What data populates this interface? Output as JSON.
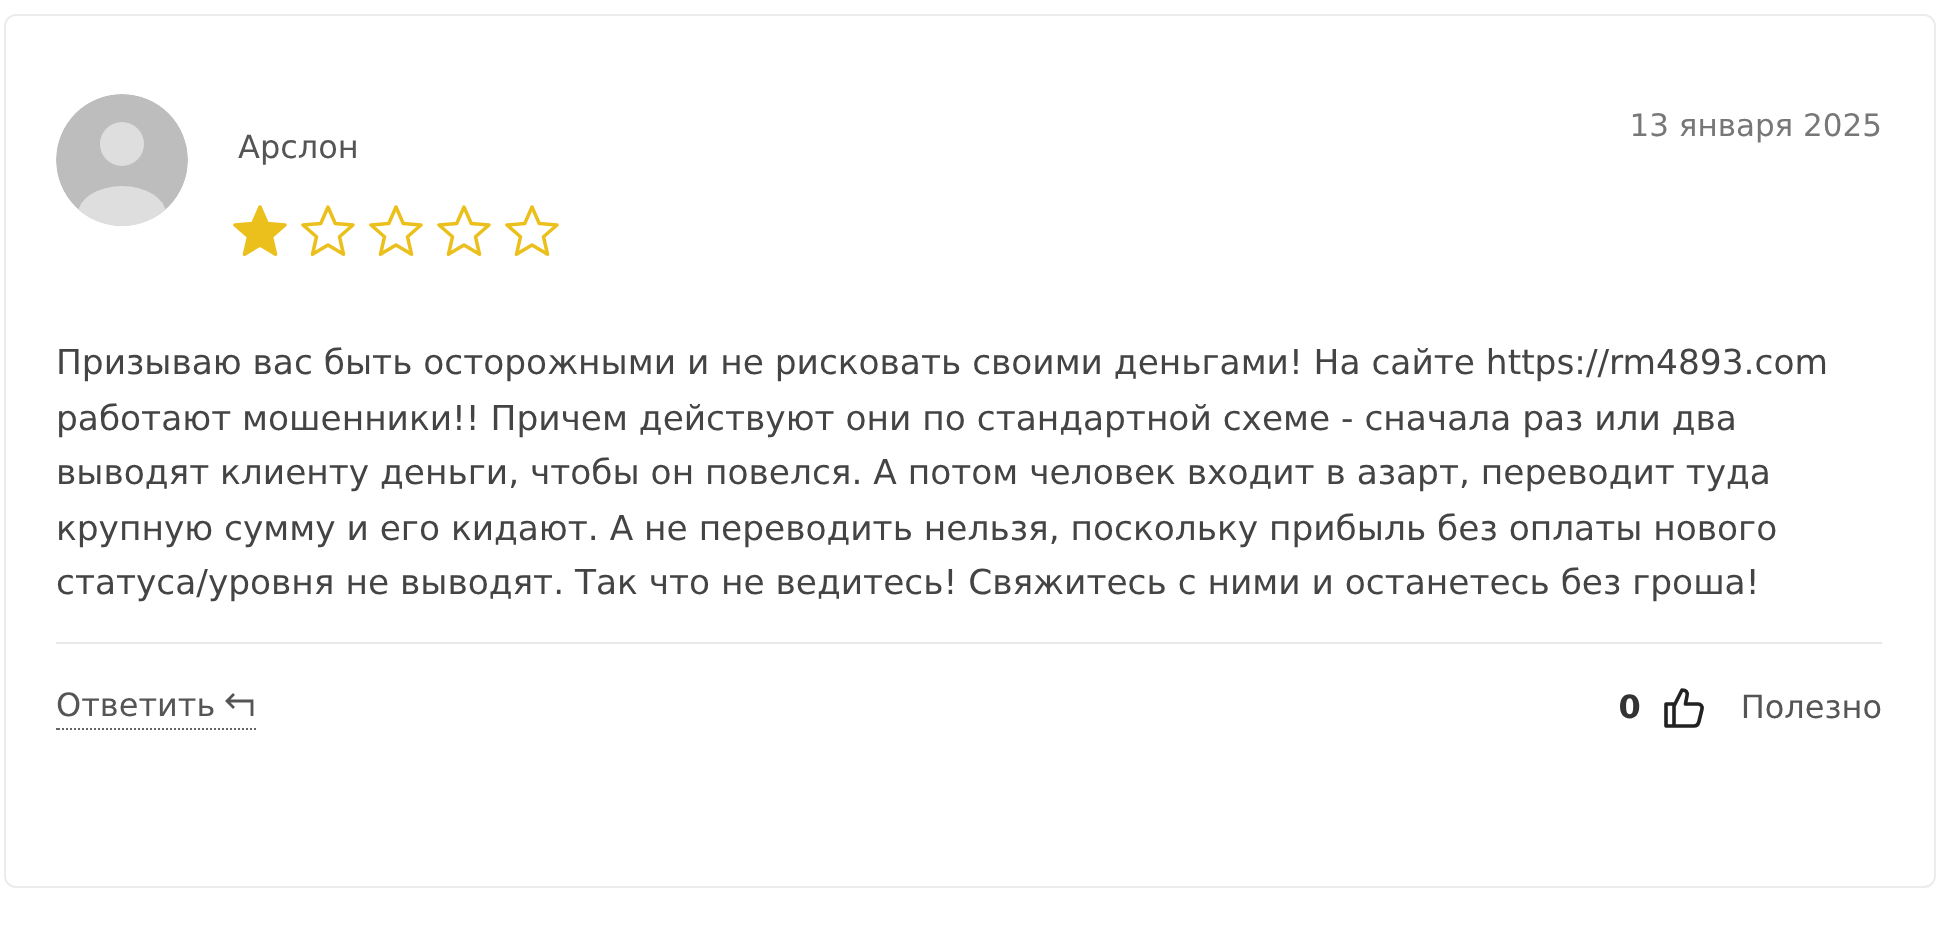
{
  "review": {
    "author": "Арслон",
    "date": "13 января 2025",
    "stars": 1,
    "text": "Призываю вас быть осторожными и не рисковать своими деньгами! На сайте https://rm4893.com работают мошенники!! Причем действуют они по стандартной схеме - сначала раз или два выводят клиенту деньги, чтобы он повелся. А потом человек входит в азарт, переводит туда крупную сумму и его кидают. А не переводить нельзя, поскольку прибыль без оплаты нового статуса/уровня не выводят. Так что не ведитесь! Свяжитесь с ними и останетесь без гроша!",
    "reply_label": "Ответить",
    "helpful_count": "0",
    "helpful_label": "Полезно"
  }
}
